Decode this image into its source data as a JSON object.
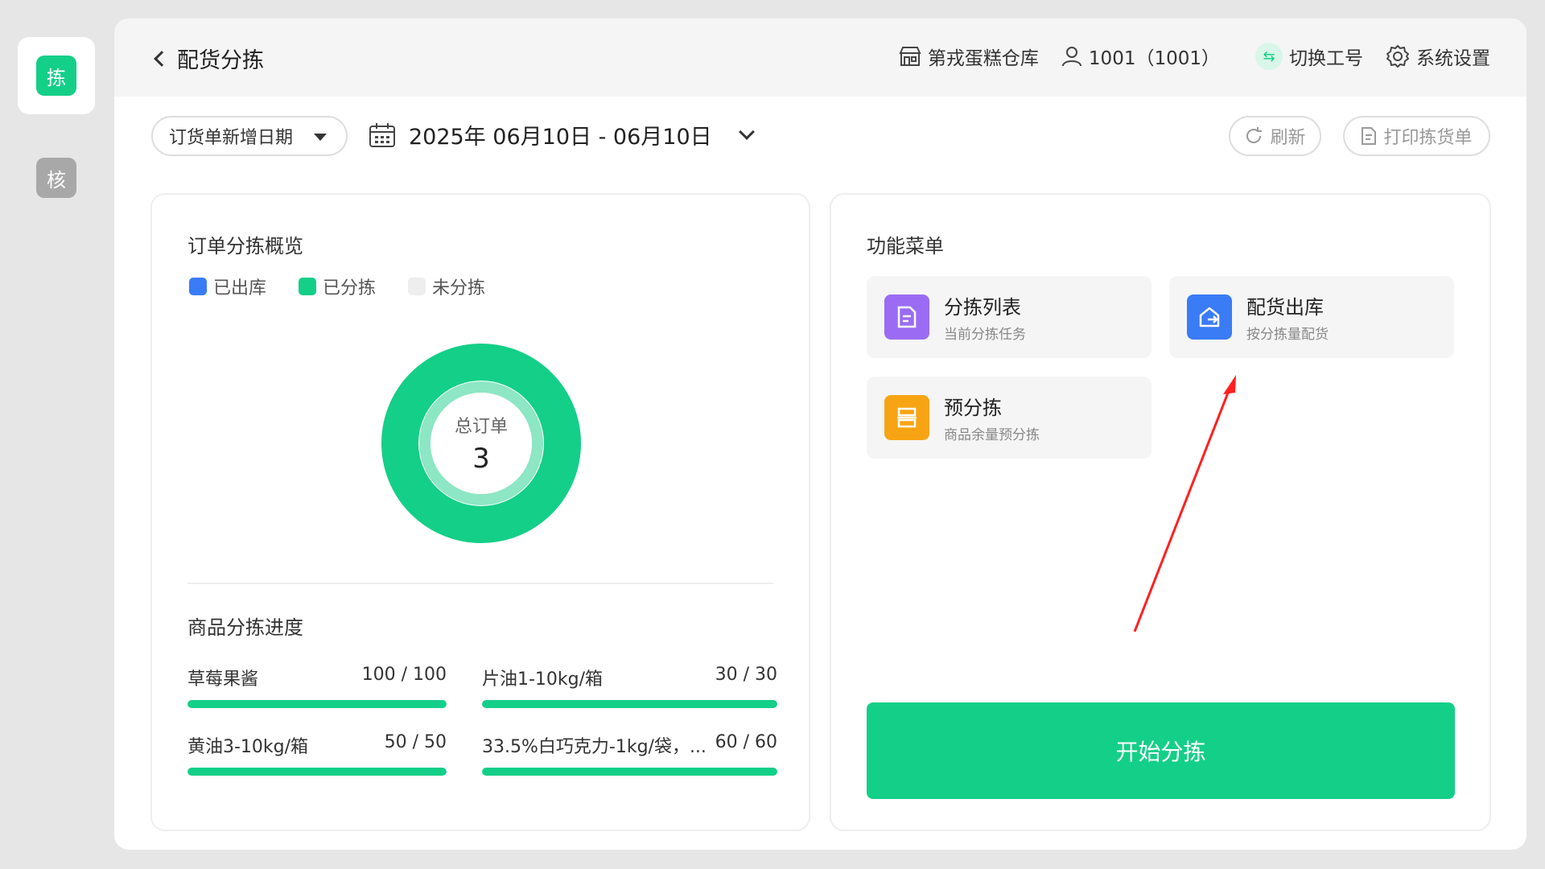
{
  "rail": {
    "sort_label": "拣",
    "check_label": "核"
  },
  "header": {
    "title": "配货分拣",
    "warehouse": "第戎蛋糕仓库",
    "user": "1001（1001）",
    "switch_label": "切换工号",
    "settings_label": "系统设置"
  },
  "filters": {
    "date_type": "订货单新增日期",
    "date_range": "2025年 06月10日 - 06月10日",
    "refresh_label": "刷新",
    "print_label": "打印拣货单"
  },
  "overview": {
    "title": "订单分拣概览",
    "legend": [
      {
        "label": "已出库",
        "color": "#3a7bf6"
      },
      {
        "label": "已分拣",
        "color": "#14cf87"
      },
      {
        "label": "未分拣",
        "color": "#eeeeee"
      }
    ],
    "total_label": "总订单",
    "total_value": "3"
  },
  "progress": {
    "title": "商品分拣进度",
    "items": [
      {
        "name": "草莓果酱",
        "value": "100 / 100",
        "fraction": 1.0
      },
      {
        "name": "片油1-10kg/箱",
        "value": "30 / 30",
        "fraction": 1.0
      },
      {
        "name": "黄油3-10kg/箱",
        "value": "50 / 50",
        "fraction": 1.0
      },
      {
        "name": "33.5%白巧克力-1kg/袋，...",
        "value": "60 / 60",
        "fraction": 1.0
      }
    ]
  },
  "menu": {
    "title": "功能菜单",
    "items": [
      {
        "name": "分拣列表",
        "sub": "当前分拣任务",
        "color": "#9b6cf3"
      },
      {
        "name": "配货出库",
        "sub": "按分拣量配货",
        "color": "#3a7bf6"
      },
      {
        "name": "预分拣",
        "sub": "商品余量预分拣",
        "color": "#f7a414"
      }
    ],
    "start_label": "开始分拣"
  },
  "colors": {
    "accent": "#14cf87",
    "annotation": "#ff2020"
  }
}
